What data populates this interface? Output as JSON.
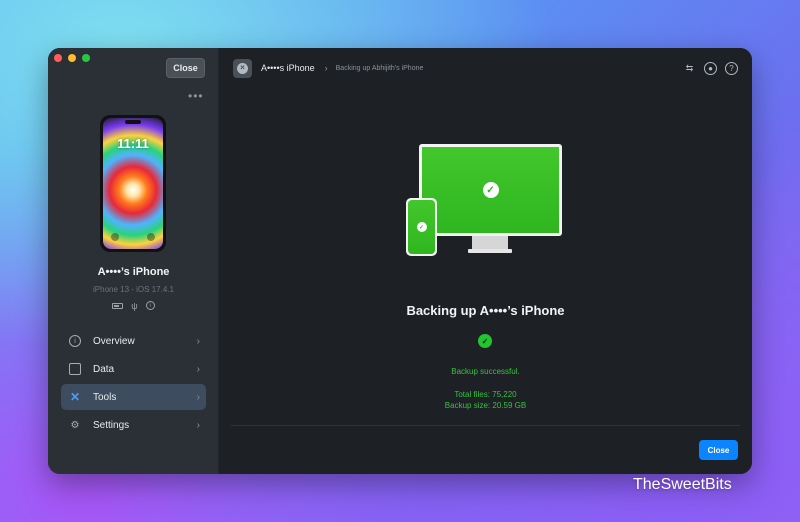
{
  "sidebar": {
    "close_label": "Close",
    "more_label": "•••",
    "device": {
      "clock": "11:11",
      "name": "A••••’s iPhone",
      "model": "iPhone 13 - iOS 17.4.1"
    },
    "nav": [
      {
        "label": "Overview",
        "icon": "info-icon"
      },
      {
        "label": "Data",
        "icon": "square-icon"
      },
      {
        "label": "Tools",
        "icon": "tools-icon",
        "active": true
      },
      {
        "label": "Settings",
        "icon": "gear-icon"
      }
    ]
  },
  "header": {
    "device_crumb": "A••••s iPhone",
    "step_crumb": "Backing up Abhijith's iPhone"
  },
  "main": {
    "title": "Backing up A••••’s iPhone",
    "success_text": "Backup successful.",
    "total_files": "Total files: 75,220",
    "backup_size": "Backup size: 20.59 GB",
    "close_label": "Close"
  },
  "watermark": "TheSweetBits",
  "colors": {
    "accent": "#0a84ff",
    "success": "#35c23c",
    "sidebar_bg": "#2b3037",
    "main_bg": "#1d2126"
  }
}
